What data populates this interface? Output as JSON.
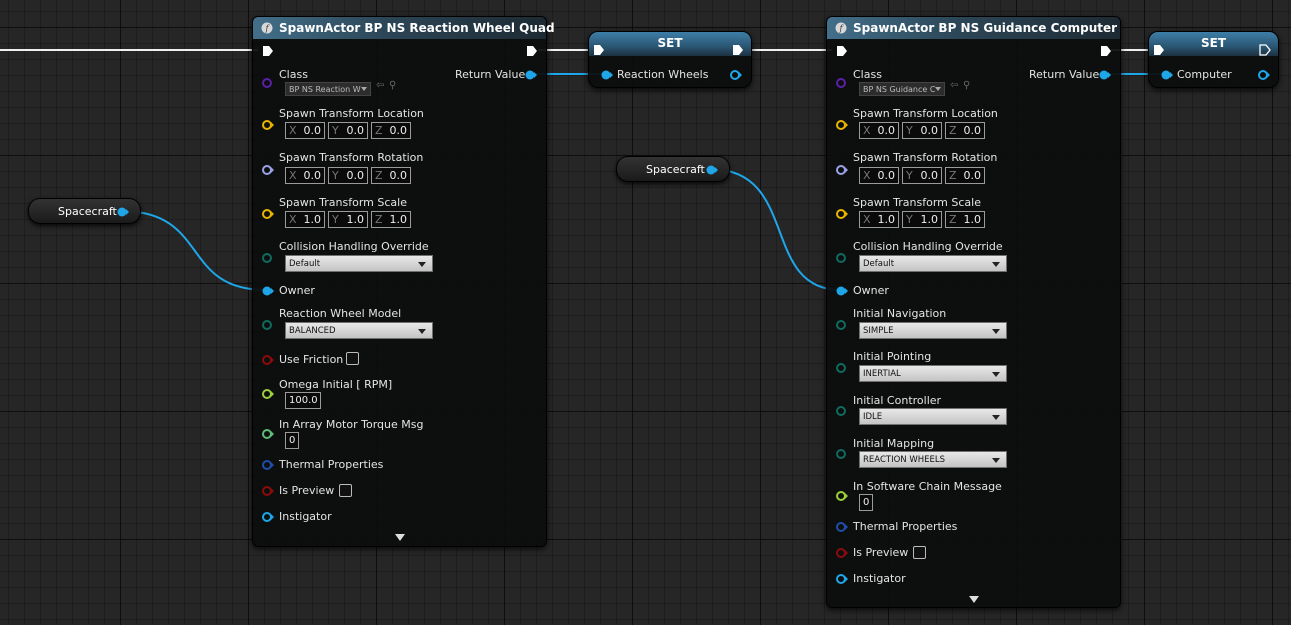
{
  "node1": {
    "title": "SpawnActor BP NS Reaction Wheel Quad",
    "class_label": "Class",
    "class_value": "BP NS Reaction W",
    "return_label": "Return Value",
    "loc_label": "Spawn Transform Location",
    "loc": [
      "0.0",
      "0.0",
      "0.0"
    ],
    "rot_label": "Spawn Transform Rotation",
    "rot": [
      "0.0",
      "0.0",
      "0.0"
    ],
    "scale_label": "Spawn Transform Scale",
    "scale": [
      "1.0",
      "1.0",
      "1.0"
    ],
    "collision_label": "Collision Handling Override",
    "collision_value": "Default",
    "owner_label": "Owner",
    "model_label": "Reaction Wheel Model",
    "model_value": "BALANCED",
    "friction_label": "Use Friction",
    "omega_label": "Omega Initial [ RPM]",
    "omega_value": "100.0",
    "torque_label": "In Array Motor Torque Msg",
    "torque_value": "0",
    "thermal_label": "Thermal Properties",
    "preview_label": "Is Preview",
    "instigator_label": "Instigator"
  },
  "node2": {
    "title": "SpawnActor BP NS Guidance Computer",
    "class_label": "Class",
    "class_value": "BP NS Guidance C",
    "return_label": "Return Value",
    "loc_label": "Spawn Transform Location",
    "loc": [
      "0.0",
      "0.0",
      "0.0"
    ],
    "rot_label": "Spawn Transform Rotation",
    "rot": [
      "0.0",
      "0.0",
      "0.0"
    ],
    "scale_label": "Spawn Transform Scale",
    "scale": [
      "1.0",
      "1.0",
      "1.0"
    ],
    "collision_label": "Collision Handling Override",
    "collision_value": "Default",
    "owner_label": "Owner",
    "nav_label": "Initial Navigation",
    "nav_value": "SIMPLE",
    "pointing_label": "Initial Pointing",
    "pointing_value": "INERTIAL",
    "controller_label": "Initial Controller",
    "controller_value": "IDLE",
    "mapping_label": "Initial Mapping",
    "mapping_value": "REACTION WHEELS",
    "chain_label": "In Software Chain Message",
    "chain_value": "0",
    "thermal_label": "Thermal Properties",
    "preview_label": "Is Preview",
    "instigator_label": "Instigator"
  },
  "set1": {
    "title": "SET",
    "pin_label": "Reaction Wheels"
  },
  "set2": {
    "title": "SET",
    "pin_label": "Computer"
  },
  "var1": {
    "label": "Spacecraft"
  },
  "var2": {
    "label": "Spacecraft"
  },
  "axes": {
    "x": "X",
    "y": "Y",
    "z": "Z"
  },
  "colors": {
    "object_pin": "#1fa6e8",
    "vector_pin": "#e8b400",
    "rotator_pin": "#9aa2e6",
    "enum_pin": "#0f6b5f",
    "bool_pin": "#8b0b0b",
    "float_pin": "#9ccf3d",
    "int_pin": "#5fba78",
    "struct_pin": "#1f4ea8",
    "class_pin": "#5b1fa8",
    "header": "#436f8a"
  },
  "icons": {
    "function": "function-icon",
    "browse": "browse-icon",
    "search": "search-icon"
  }
}
